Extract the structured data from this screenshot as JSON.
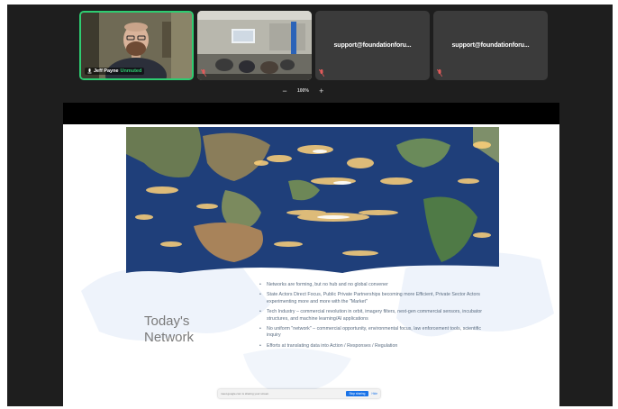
{
  "participants": [
    {
      "name": "Jeff Payne",
      "badge": "Unmuted",
      "muted": false
    },
    {
      "name": "",
      "muted": true
    },
    {
      "name": "support@foundationforu...",
      "muted": true
    },
    {
      "name": "support@foundationforu...",
      "muted": true
    }
  ],
  "zoom": {
    "minus": "−",
    "value": "100%",
    "plus": "+"
  },
  "slide": {
    "title": "Today's Network",
    "bullets": [
      "Networks are forming, but no hub and no global convener",
      "State Actors Direct Focus, Public Private Partnerships becoming more Efficient, Private Sector Actors experimenting more and more with the \"Market\"",
      "Tech Industry – commercial revolution in orbit, imagery filters, next-gen commercial sensors, incubator structures, and machine learning/AI applications",
      "No uniform \"network\" – commercial opportunity, environmental focus, law enforcement tools, scientific inquiry",
      "Efforts at translating data into Action / Responses / Regulation"
    ]
  },
  "share_bar": {
    "message": "meet.google.com is sharing your screen.",
    "stop_label": "Stop sharing",
    "hide_label": "Hide"
  },
  "colors": {
    "speaker_border": "#2ecc71",
    "accent": "#1a73e8",
    "ocean": "#1f3f7a"
  }
}
